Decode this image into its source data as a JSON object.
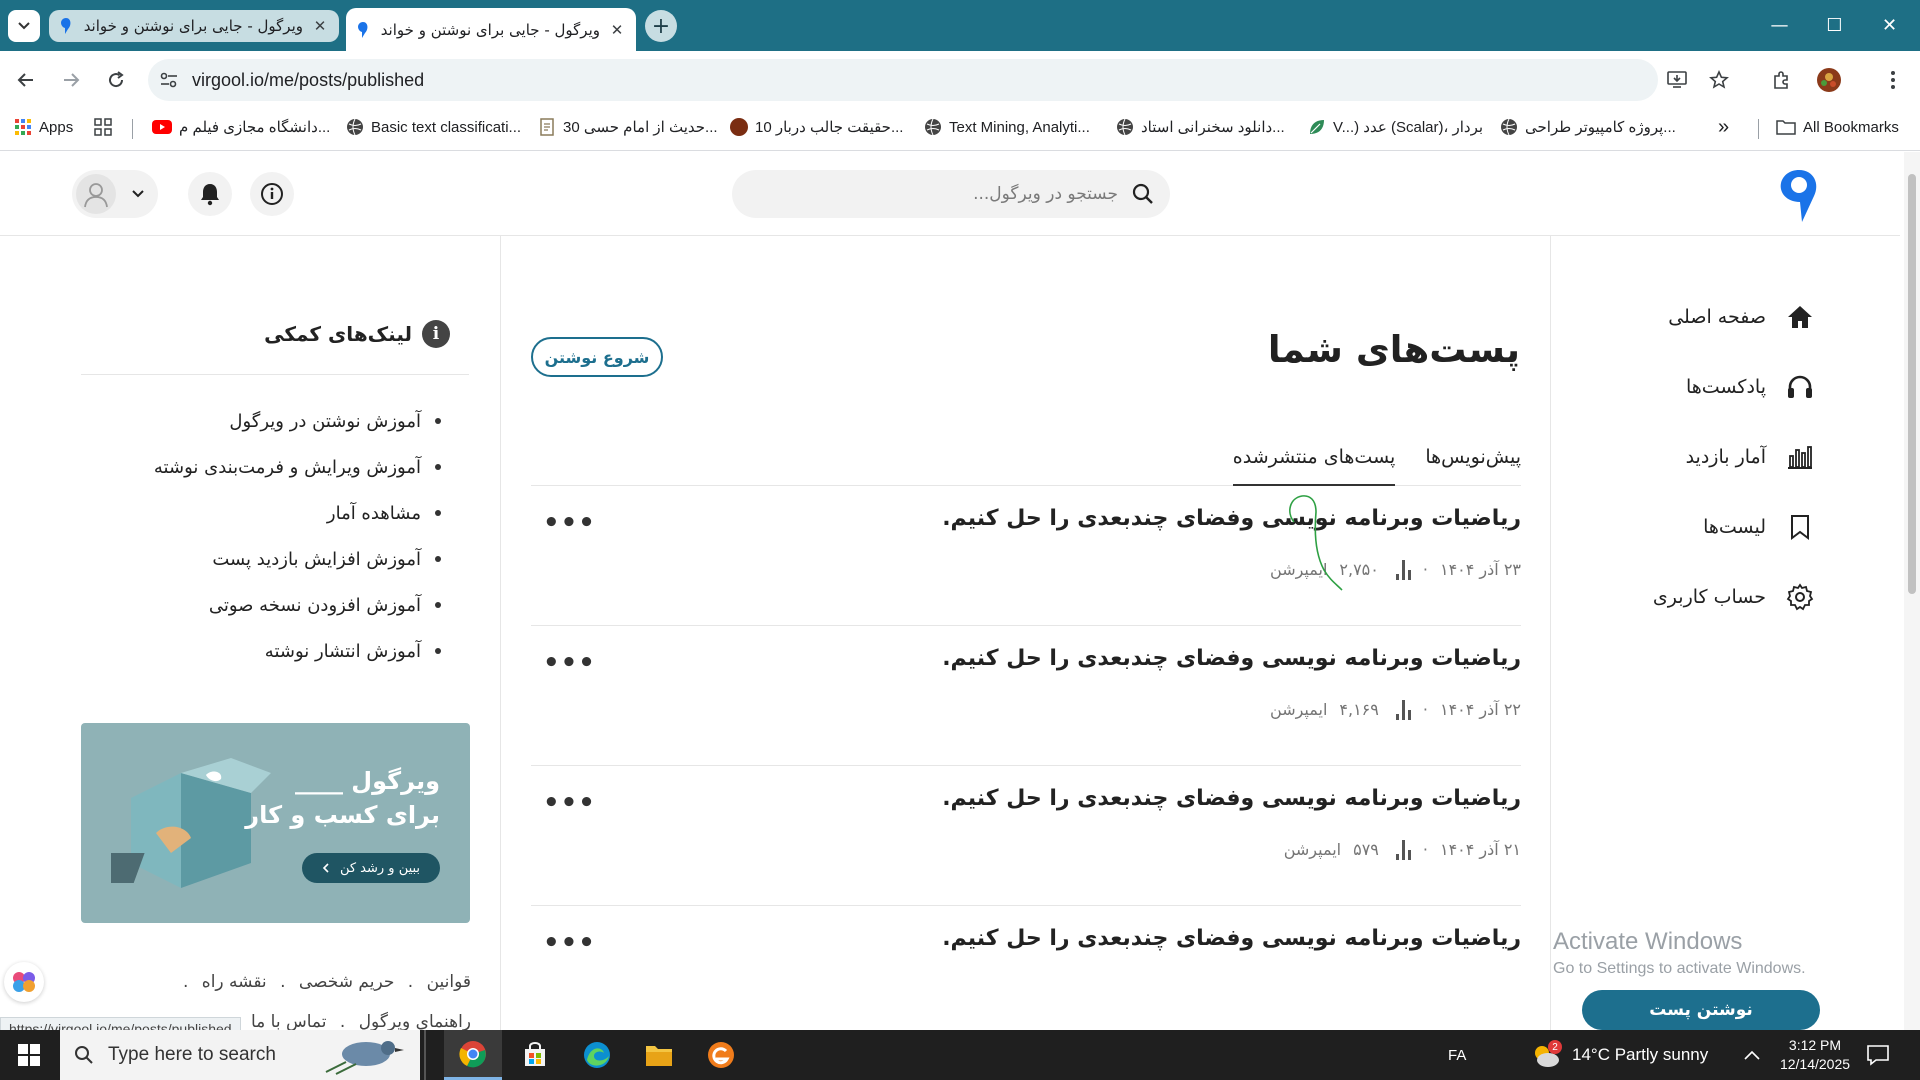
{
  "browser": {
    "tabs": [
      {
        "title": "ویرگول - جایی برای نوشتن و خواند",
        "active": false
      },
      {
        "title": "ویرگول - جایی برای نوشتن و خواند",
        "active": true
      }
    ],
    "close_glyph": "✕",
    "new_tab_glyph": "+",
    "url": "virgool.io/me/posts/published",
    "window_controls": [
      "—",
      "☐",
      "✕"
    ]
  },
  "bookmarks": [
    {
      "label": "Apps",
      "icon": "apps-grid-icon",
      "color": "#4285f4"
    },
    {
      "label": "دانشگاه مجازی فیلم م...",
      "icon": "youtube-icon",
      "color": "#ff0000"
    },
    {
      "label": "Basic text classificati...",
      "icon": "globe-icon",
      "color": "#444444"
    },
    {
      "label": "30 حدیث از امام حسی...",
      "icon": "doc-icon",
      "color": "#8a7b5a"
    },
    {
      "label": "10 حقیقت جالب دربار...",
      "icon": "site-icon",
      "color": "#7a2d12"
    },
    {
      "label": "Text Mining, Analyti...",
      "icon": "globe-icon",
      "color": "#444444"
    },
    {
      "label": "دانلود سخنرانی استاد...",
      "icon": "globe-icon",
      "color": "#444444"
    },
    {
      "label": "V...) عدد (Scalar)، بردار",
      "icon": "leaf-icon",
      "color": "#2e8b57"
    },
    {
      "label": "پروژه کامپیوتر طراحی...",
      "icon": "globe-icon",
      "color": "#444444"
    }
  ],
  "bookmarks_more": "»",
  "all_bookmarks": "All Bookmarks",
  "header": {
    "search_placeholder": "جستجو در ویرگول..."
  },
  "right_nav": [
    {
      "label": "صفحه اصلی",
      "icon": "home-icon"
    },
    {
      "label": "پادکست‌ها",
      "icon": "headphones-icon"
    },
    {
      "label": "آمار بازدید",
      "icon": "stats-icon"
    },
    {
      "label": "لیست‌ها",
      "icon": "bookmark-icon"
    },
    {
      "label": "حساب کاربری",
      "icon": "gear-icon"
    }
  ],
  "main": {
    "title": "پست‌های شما",
    "write_button": "شروع نوشتن",
    "tabs": [
      {
        "label": "پیش‌نویس‌ها",
        "active": false
      },
      {
        "label": "پست‌های منتشرشده",
        "active": true
      }
    ],
    "posts": [
      {
        "title": "ریاضیات وبرنامه نویسی وفضای چندبعدی را حل کنیم.",
        "date": "۲۳ آذر ۱۴۰۴",
        "impressions": "۲,۷۵۰",
        "impressions_label": "ایمپرشن"
      },
      {
        "title": "ریاضیات وبرنامه نویسی وفضای چندبعدی را حل کنیم.",
        "date": "۲۲ آذر ۱۴۰۴",
        "impressions": "۴,۱۶۹",
        "impressions_label": "ایمپرشن"
      },
      {
        "title": "ریاضیات وبرنامه نویسی وفضای چندبعدی را حل کنیم.",
        "date": "۲۱ آذر ۱۴۰۴",
        "impressions": "۵۷۹",
        "impressions_label": "ایمپرشن"
      },
      {
        "title": "ریاضیات وبرنامه نویسی وفضای چندبعدی را حل کنیم.",
        "date": "",
        "impressions": "",
        "impressions_label": ""
      }
    ],
    "more_glyph": "•••",
    "meta_sep": "·"
  },
  "sidebar": {
    "heading": "لینک‌های کمکی",
    "links": [
      "آموزش نوشتن در ویرگول",
      "آموزش ویرایش و فرمت‌بندی نوشته",
      "مشاهده آمار",
      "آموزش افزایش بازدید پست",
      "آموزش افزودن نسخه صوتی",
      "آموزش انتشار نوشته"
    ],
    "banner": {
      "line1": "ویرگول ____",
      "line2": "برای کسب و کار",
      "button": "ببین و رشد کن"
    },
    "footer_row1": [
      "قوانین",
      "حریم شخصی",
      "نقشه راه"
    ],
    "footer_row2": [
      "راهنمای ویرگول",
      "تماس با ما"
    ],
    "footer_sep": "."
  },
  "status_url": "https://virgool.io/me/posts/published",
  "activate": {
    "line1": "Activate Windows",
    "line2": "Go to Settings to activate Windows."
  },
  "write_post_button": "نوشتن پست",
  "taskbar": {
    "search_placeholder": "Type here to search",
    "lang": "FA",
    "weather": "14°C  Partly sunny",
    "weather_badge": "2",
    "time": "3:12 PM",
    "date": "12/14/2025"
  },
  "colors": {
    "accent": "#1d6f8e",
    "chrome_frame": "#1e6f85"
  }
}
